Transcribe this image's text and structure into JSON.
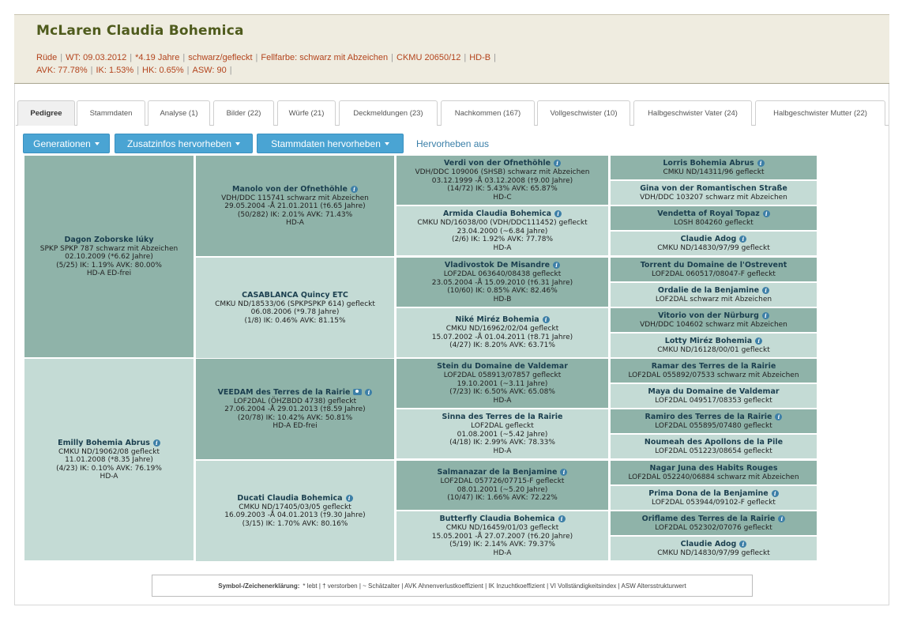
{
  "title": "McLaren Claudia Bohemica",
  "meta_line1": [
    "Rüde",
    "WT: 09.03.2012",
    "*4.19 Jahre",
    "schwarz/gefleckt",
    "Fellfarbe: schwarz mit Abzeichen",
    "CKMU 20650/12",
    "HD-B"
  ],
  "meta_line2": [
    "AVK: 77.78%",
    "IK: 1.53%",
    "HK: 0.65%",
    "ASW: 90"
  ],
  "tabs": [
    {
      "label": "Pedigree",
      "active": true
    },
    {
      "label": "Stammdaten"
    },
    {
      "label": "Analyse (1)"
    },
    {
      "label": "Bilder (22)"
    },
    {
      "label": "Würfe (21)"
    },
    {
      "label": "Deckmeldungen (23)"
    },
    {
      "label": "Nachkommen (167)"
    },
    {
      "label": "Vollgeschwister (10)"
    },
    {
      "label": "Halbgeschwister Vater (24)"
    },
    {
      "label": "Halbgeschwister Mutter (22)"
    }
  ],
  "toolbar": {
    "generations": "Generationen",
    "extra": "Zusatzinfos hervorheben",
    "master": "Stammdaten hervorheben",
    "clear": "Hervorheben aus"
  },
  "pedigree": {
    "gen1": [
      {
        "name": "Dagon Zoborske lúky",
        "info": false,
        "lines": [
          "SPKP SPKP 787 schwarz mit Abzeichen",
          "02.10.2009 (*6.62 Jahre)",
          "(5/25) IK: 1.19% AVK: 80.00%",
          "HD-A ED-frei"
        ]
      },
      {
        "name": "Emilly Bohemia Abrus",
        "info": true,
        "lines": [
          "CMKU ND/19062/08 gefleckt",
          "11.01.2008 (*8.35 Jahre)",
          "(4/23) IK: 0.10% AVK: 76.19%",
          "HD-A"
        ]
      }
    ],
    "gen2": [
      {
        "name": "Manolo von der Ofnethöhle",
        "info": true,
        "lines": [
          "VDH/DDC 115741 schwarz mit Abzeichen",
          "29.05.2004 -Å 21.01.2011 (†6.65 Jahre)",
          "(50/282) IK: 2.01% AVK: 71.43%",
          "HD-A"
        ]
      },
      {
        "name": "CASABLANCA Quincy ETC",
        "info": false,
        "lines": [
          "CMKU ND/18533/06 (SPKPSPKP 614) gefleckt",
          "06.08.2006 (*9.78 Jahre)",
          "(1/8) IK: 0.46% AVK: 81.15%"
        ]
      },
      {
        "name": "VEEDAM des Terres de la Rairie",
        "info": true,
        "camera": true,
        "lines": [
          "LOF2DAL (ÖHZBDD 4738) gefleckt",
          "27.06.2004 -Å 29.01.2013 (†8.59 Jahre)",
          "(20/78) IK: 10.42% AVK: 50.81%",
          "HD-A ED-frei"
        ]
      },
      {
        "name": "Ducati Claudia Bohemica",
        "info": true,
        "lines": [
          "CMKU ND/17405/03/05 gefleckt",
          "16.09.2003 -Å 04.01.2013 (†9.30 Jahre)",
          "(3/15) IK: 1.70% AVK: 80.16%"
        ]
      }
    ],
    "gen3": [
      {
        "name": "Verdi von der Ofnethöhle",
        "info": true,
        "lines": [
          "VDH/DDC 109006 (SHSB) schwarz mit Abzeichen",
          "03.12.1999 -Å 03.12.2008 (†9.00 Jahre)",
          "(14/72) IK: 5.43% AVK: 65.87%",
          "HD-C"
        ]
      },
      {
        "name": "Armida Claudia Bohemica",
        "info": true,
        "lines": [
          "CMKU ND/16038/00 (VDH/DDC111452) gefleckt",
          "23.04.2000 (~6.84 Jahre)",
          "(2/6) IK: 1.92% AVK: 77.78%",
          "HD-A"
        ]
      },
      {
        "name": "Vladivostok De Misandre",
        "info": true,
        "lines": [
          "LOF2DAL 063640/08438 gefleckt",
          "23.05.2004 -Å 15.09.2010 (†6.31 Jahre)",
          "(10/60) IK: 0.85% AVK: 82.46%",
          "HD-B"
        ]
      },
      {
        "name": "Niké Miréz Bohemia",
        "info": true,
        "lines": [
          "CMKU ND/16962/02/04 gefleckt",
          "15.07.2002 -Å 01.04.2011 (†8.71 Jahre)",
          "(4/27) IK: 8.20% AVK: 63.71%"
        ]
      },
      {
        "name": "Stein du Domaine de Valdemar",
        "info": false,
        "lines": [
          "LOF2DAL 058913/07857 gefleckt",
          "19.10.2001 (~3.11 Jahre)",
          "(7/23) IK: 6.50% AVK: 65.08%",
          "HD-A"
        ]
      },
      {
        "name": "Sinna des Terres de la Rairie",
        "info": false,
        "lines": [
          "LOF2DAL gefleckt",
          "01.08.2001 (~5.42 Jahre)",
          "(4/18) IK: 2.99% AVK: 78.33%",
          "HD-A"
        ]
      },
      {
        "name": "Salmanazar de la Benjamine",
        "info": true,
        "lines": [
          "LOF2DAL 057726/07715-F gefleckt",
          "08.01.2001 (~5.20 Jahre)",
          "(10/47) IK: 1.66% AVK: 72.22%"
        ]
      },
      {
        "name": "Butterfly Claudia Bohemica",
        "info": true,
        "lines": [
          "CMKU ND/16459/01/03 gefleckt",
          "15.05.2001 -Å 27.07.2007 (†6.20 Jahre)",
          "(5/19) IK: 2.14% AVK: 79.37%",
          "HD-A"
        ]
      }
    ],
    "gen4": [
      {
        "name": "Lorris Bohemia Abrus",
        "info": true,
        "lines": [
          "CMKU ND/14311/96 gefleckt"
        ]
      },
      {
        "name": "Gina von der Romantischen Straße",
        "info": false,
        "lines": [
          "VDH/DDC 103207 schwarz mit Abzeichen"
        ]
      },
      {
        "name": "Vendetta of Royal Topaz",
        "info": true,
        "lines": [
          "LOSH 804260 gefleckt"
        ]
      },
      {
        "name": "Claudie Adog",
        "info": true,
        "lines": [
          "CMKU ND/14830/97/99 gefleckt"
        ]
      },
      {
        "name": "Torrent du Domaine de l'Ostrevent",
        "info": false,
        "lines": [
          "LOF2DAL 060517/08047-F gefleckt"
        ]
      },
      {
        "name": "Ordalie de la Benjamine",
        "info": true,
        "lines": [
          "LOF2DAL schwarz mit Abzeichen"
        ]
      },
      {
        "name": "Vitorio von der Nürburg",
        "info": true,
        "lines": [
          "VDH/DDC 104602 schwarz mit Abzeichen"
        ]
      },
      {
        "name": "Lotty Miréz Bohemia",
        "info": true,
        "lines": [
          "CMKU ND/16128/00/01 gefleckt"
        ]
      },
      {
        "name": "Ramar des Terres de la Rairie",
        "info": false,
        "lines": [
          "LOF2DAL 055892/07533 schwarz mit Abzeichen"
        ]
      },
      {
        "name": "Maya du Domaine de Valdemar",
        "info": false,
        "lines": [
          "LOF2DAL 049517/08353 gefleckt"
        ]
      },
      {
        "name": "Ramiro des Terres de la Rairie",
        "info": true,
        "lines": [
          "LOF2DAL 055895/07480 gefleckt"
        ]
      },
      {
        "name": "Noumeah des Apollons de la Pile",
        "info": false,
        "lines": [
          "LOF2DAL 051223/08654 gefleckt"
        ]
      },
      {
        "name": "Nagar Juna des Habits Rouges",
        "info": false,
        "lines": [
          "LOF2DAL 052240/06884 schwarz mit Abzeichen"
        ]
      },
      {
        "name": "Prima Dona de la Benjamine",
        "info": true,
        "lines": [
          "LOF2DAL 053944/09102-F gefleckt"
        ]
      },
      {
        "name": "Oriflame des Terres de la Rairie",
        "info": true,
        "lines": [
          "LOF2DAL 052302/07076 gefleckt"
        ]
      },
      {
        "name": "Claudie Adog",
        "info": true,
        "lines": [
          "CMKU ND/14830/97/99 gefleckt"
        ]
      }
    ]
  },
  "legend": {
    "title": "Symbol-/Zeichenerklärung:",
    "text": "* lebt | † verstorben | ~ Schätzalter | AVK Ahnenverlustkoeffizient | IK Inzuchtkoeffizient | VI Vollständigkeitsindex | ASW Altersstrukturwert"
  }
}
